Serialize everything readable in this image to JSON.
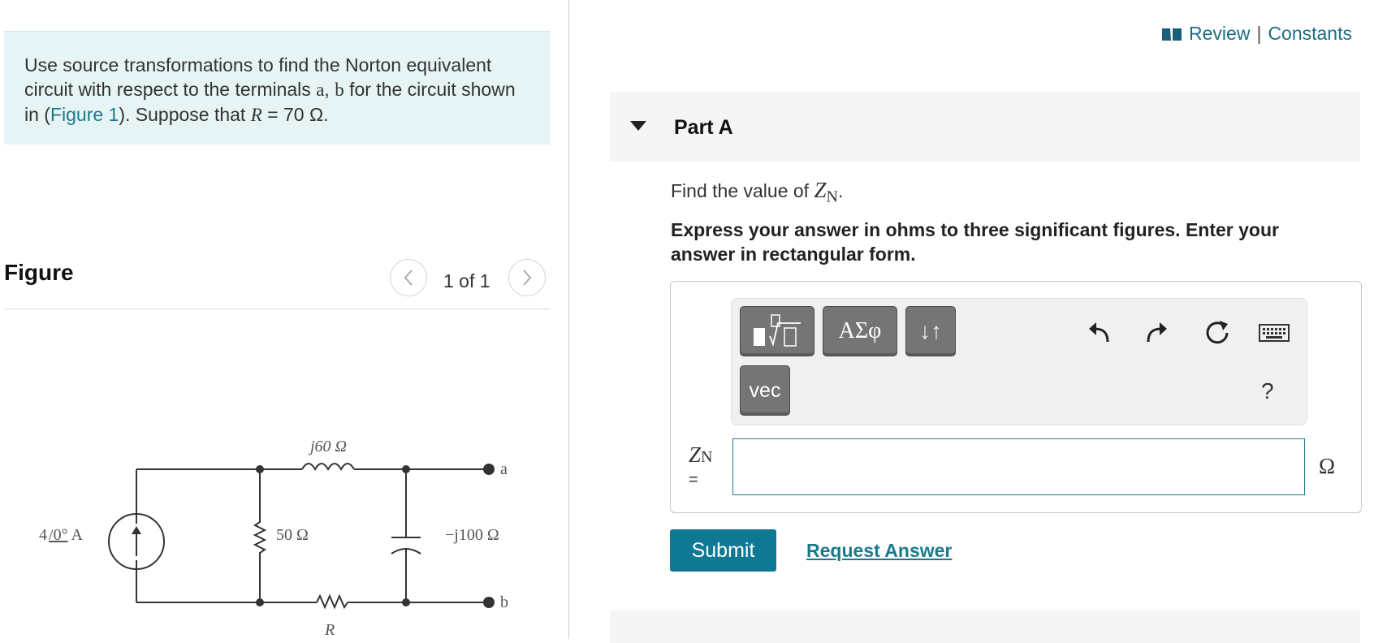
{
  "problem": {
    "text_1": "Use source transformations to find the Norton equivalent circuit with respect to the terminals ",
    "terminal_a": "a",
    "comma": ", ",
    "terminal_b": "b",
    "text_2": " for the circuit shown in (",
    "figure_link": "Figure 1",
    "text_3": "). Suppose that ",
    "r_symbol": "R",
    "r_value": " = 70 Ω."
  },
  "figure": {
    "title": "Figure",
    "counter": "1 of 1",
    "prev_icon": "chevron-left-icon",
    "next_icon": "chevron-right-icon"
  },
  "circuit_labels": {
    "source": "4",
    "source_angle": "0°",
    "source_unit": " A",
    "inductor": "j60 Ω",
    "resistor_50": "50 Ω",
    "capacitor": "−j100 Ω",
    "resistor_r": "R",
    "terminal_a": "a",
    "terminal_b": "b"
  },
  "top_links": {
    "icon": "book-icon",
    "review": "Review",
    "separator": "|",
    "constants": "Constants"
  },
  "part": {
    "title": "Part A",
    "find_prefix": "Find the value of ",
    "z_symbol": "Z",
    "z_sub": "N",
    "find_suffix": ".",
    "instructions": "Express your answer in ohms to three significant figures. Enter your answer in rectangular form."
  },
  "toolbar": {
    "greek": "ΑΣφ",
    "arrows": "↓↑",
    "vec": "vec",
    "help": "?"
  },
  "answer": {
    "label_symbol": "Z",
    "label_sub": "N",
    "label_eq": "=",
    "value": "",
    "unit": "Ω"
  },
  "actions": {
    "submit": "Submit",
    "request_answer": "Request Answer"
  },
  "colors": {
    "accent": "#0f7892",
    "link": "#1a7a8c",
    "problem_bg": "#e6f4f5"
  }
}
